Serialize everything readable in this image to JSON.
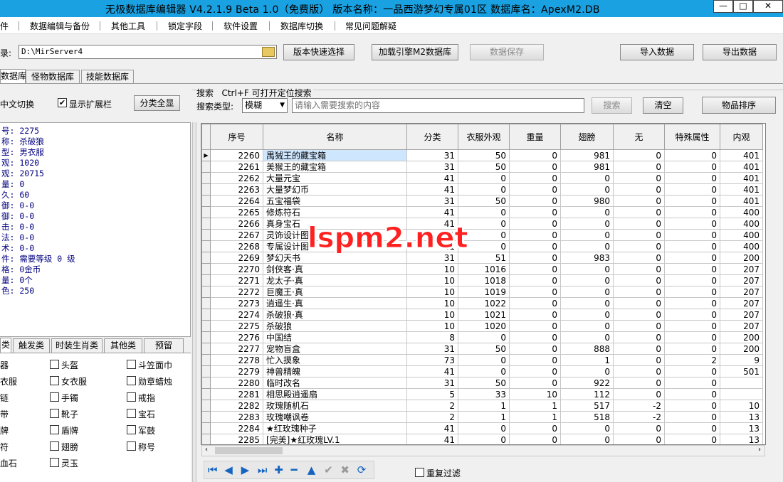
{
  "window": {
    "title": "无极数据库编辑器 V4.2.1.9    Beta 1.0（免费版）    版本名称：一品西游梦幻专属01区    数据库名：ApexM2.DB",
    "min_glyph": "—",
    "max_glyph": "□",
    "close_glyph": "✕"
  },
  "menu": [
    "件",
    "数据编辑与备份",
    "其他工具",
    "锁定字段",
    "软件设置",
    "数据库切换",
    "常见问题解疑"
  ],
  "toolbar": {
    "dir_label": "录:",
    "dir_value": "D:\\MirServer4",
    "version_quick_select": "版本快速选择",
    "load_engine_db": "加载引擎M2数据库",
    "save_data": "数据保存",
    "import_data": "导入数据",
    "export_data": "导出数据"
  },
  "db_tabs": [
    "数据库",
    "怪物数据库",
    "技能数据库"
  ],
  "options": {
    "lang_switch": "中文切换",
    "show_ext_bar": "显示扩展栏",
    "show_ext_bar_checked": true,
    "show_all_categories": "分类全显"
  },
  "search": {
    "title": "搜索   Ctrl+F 可打开定位搜索",
    "type_label": "搜索类型:",
    "type_value": "模糊",
    "placeholder": "请输入需要搜索的内容",
    "search_button": "搜索",
    "clear_button": "清空",
    "sort_button": "物品排序"
  },
  "info_lines": [
    "号: 2275",
    "称: 杀破狼",
    "型: 男衣服",
    "观: 1020",
    "观: 20715",
    "量: 0",
    "久: 60",
    " 御: 0-0",
    " 御: 0-0",
    " 击: 0-0",
    " 法: 0-0",
    " 术: 0-0",
    "件: 需要等级 0 级",
    "格: 0金币",
    "量: 0个",
    "色: 250"
  ],
  "category_tabs": [
    "类",
    "触发类",
    "时装生肖类",
    "其他类",
    "预留"
  ],
  "categories": [
    [
      "器",
      "头盔",
      "斗笠面巾"
    ],
    [
      "衣服",
      "女衣服",
      "勋章蜡烛"
    ],
    [
      "链",
      "手镯",
      "戒指"
    ],
    [
      "带",
      "靴子",
      "宝石"
    ],
    [
      "牌",
      "盾牌",
      "军鼓"
    ],
    [
      "符",
      "翅膀",
      "称号"
    ],
    [
      "血石",
      "灵玉",
      ""
    ]
  ],
  "table": {
    "columns": [
      "序号",
      "名称",
      "分类",
      "衣服外观",
      "重量",
      "翅膀",
      "无",
      "特殊属性",
      "内观"
    ],
    "rows": [
      [
        "2260",
        "禺狨王的藏宝箱",
        "31",
        "50",
        "0",
        "981",
        "0",
        "0",
        "401"
      ],
      [
        "2261",
        "美猴王的藏宝箱",
        "31",
        "50",
        "0",
        "981",
        "0",
        "0",
        "401"
      ],
      [
        "2262",
        "大量元宝",
        "41",
        "0",
        "0",
        "0",
        "0",
        "0",
        "401"
      ],
      [
        "2263",
        "大量梦幻币",
        "41",
        "0",
        "0",
        "0",
        "0",
        "0",
        "401"
      ],
      [
        "2264",
        "五宝福袋",
        "31",
        "50",
        "0",
        "980",
        "0",
        "0",
        "401"
      ],
      [
        "2265",
        "修炼符石",
        "41",
        "0",
        "0",
        "0",
        "0",
        "0",
        "400"
      ],
      [
        "2266",
        "真身宝石",
        "41",
        "0",
        "0",
        "0",
        "0",
        "0",
        "400"
      ],
      [
        "2267",
        "灵饰设计图",
        "41",
        "0",
        "0",
        "0",
        "0",
        "0",
        "400"
      ],
      [
        "2268",
        "专属设计图",
        "41",
        "0",
        "0",
        "0",
        "0",
        "0",
        "400"
      ],
      [
        "2269",
        "梦幻天书",
        "31",
        "51",
        "0",
        "983",
        "0",
        "0",
        "200"
      ],
      [
        "2270",
        "剑侠客·真",
        "10",
        "1016",
        "0",
        "0",
        "0",
        "0",
        "207"
      ],
      [
        "2271",
        "龙太子·真",
        "10",
        "1018",
        "0",
        "0",
        "0",
        "0",
        "207"
      ],
      [
        "2272",
        "巨魔王·真",
        "10",
        "1019",
        "0",
        "0",
        "0",
        "0",
        "207"
      ],
      [
        "2273",
        "逍遥生·真",
        "10",
        "1022",
        "0",
        "0",
        "0",
        "0",
        "207"
      ],
      [
        "2274",
        "杀破狼·真",
        "10",
        "1021",
        "0",
        "0",
        "0",
        "0",
        "207"
      ],
      [
        "2275",
        "杀破狼",
        "10",
        "1020",
        "0",
        "0",
        "0",
        "0",
        "207"
      ],
      [
        "2276",
        "中国结",
        "8",
        "0",
        "0",
        "0",
        "0",
        "0",
        "200"
      ],
      [
        "2277",
        "宠物盲盒",
        "31",
        "50",
        "0",
        "888",
        "0",
        "0",
        "200"
      ],
      [
        "2278",
        "忙入摸象",
        "73",
        "0",
        "0",
        "1",
        "0",
        "2",
        "9"
      ],
      [
        "2279",
        "神兽精魄",
        "41",
        "0",
        "0",
        "0",
        "0",
        "0",
        "501"
      ],
      [
        "2280",
        "临时改名",
        "31",
        "50",
        "0",
        "922",
        "0",
        "0",
        ""
      ],
      [
        "2281",
        "相思殿逍遥扇",
        "5",
        "33",
        "10",
        "112",
        "0",
        "0",
        ""
      ],
      [
        "2282",
        "玫瑰随机石",
        "2",
        "1",
        "1",
        "517",
        "-2",
        "0",
        "10"
      ],
      [
        "2283",
        "玫瑰嘲讽卷",
        "2",
        "1",
        "1",
        "518",
        "-2",
        "0",
        "13"
      ],
      [
        "2284",
        "★红玫瑰种子",
        "41",
        "0",
        "0",
        "0",
        "0",
        "0",
        "13"
      ],
      [
        "2285",
        "[完美]★红玫瑰LV.1",
        "41",
        "0",
        "0",
        "0",
        "0",
        "0",
        "13"
      ]
    ],
    "selected_row": 0
  },
  "nav": {
    "icons": [
      "first-icon",
      "prev-icon",
      "next-icon",
      "last-icon",
      "insert-icon",
      "delete-icon",
      "edit-icon",
      "post-icon",
      "cancel-icon",
      "refresh-icon"
    ],
    "glyphs": [
      "⏮",
      "◀",
      "▶",
      "⏭",
      "✚",
      "━",
      "▲",
      "✔",
      "✖",
      "⟳"
    ],
    "disabled": [
      false,
      false,
      false,
      false,
      false,
      false,
      false,
      true,
      true,
      false
    ]
  },
  "repeat_filter": "重复过滤",
  "watermark": "lspm2.net"
}
